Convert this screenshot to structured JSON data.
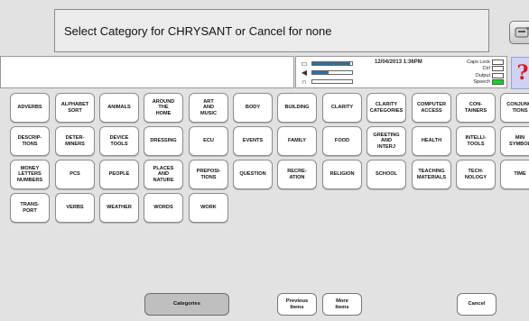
{
  "prompt": {
    "text": "Select Category for CHRYSANT or Cancel for none"
  },
  "help": {
    "label": "?"
  },
  "status": {
    "datetime": "12/04/2013 1:36PM",
    "meters": [
      {
        "icon": "calendar-icon",
        "glyph": "▭",
        "level": 0.95
      },
      {
        "icon": "speaker-icon",
        "glyph": "◀",
        "level": 0.4
      },
      {
        "icon": "headphones-icon",
        "glyph": "∩",
        "level": 0.0
      }
    ],
    "lamps": [
      {
        "label": "Caps Lock",
        "on": false
      },
      {
        "label": "Ctrl",
        "on": false
      },
      {
        "label": "Output",
        "on": false
      },
      {
        "label": "Speech",
        "on": true
      }
    ]
  },
  "categories": [
    [
      "ADVERBS",
      "ALPHABET\nSORT",
      "ANIMALS",
      "AROUND\nTHE\nHOME",
      "ART\nAND\nMUSIC",
      "BODY",
      "BUILDING",
      "CLARITY",
      "CLARITY\nCATEGORIES",
      "COMPUTER\nACCESS",
      "CON-\nTAINERS",
      "CONJUNC-\nTIONS"
    ],
    [
      "DESCRIP-\nTIONS",
      "DETER-\nMINERS",
      "DEVICE\nTOOLS",
      "DRESSING",
      "ECU",
      "EVENTS",
      "FAMILY",
      "FOOD",
      "GREETING\nAND\nINTERJ",
      "HEALTH",
      "INTELLI-\nTOOLS",
      "MIN\nSYMBOL"
    ],
    [
      "MONEY\nLETTERS\nNUMBERS",
      "PCS",
      "PEOPLE",
      "PLACES\nAND\nNATURE",
      "PREPOSI-\nTIONS",
      "QUESTION",
      "RECRE-\nATION",
      "RELIGION",
      "SCHOOL",
      "TEACHING\nMATERIALS",
      "TECH-\nNOLOGY",
      "TIME"
    ],
    [
      "TRANS-\nPORT",
      "VERBS",
      "WEATHER",
      "WORDS",
      "WORK"
    ]
  ],
  "footer": {
    "categories_label": "Categories",
    "previous_label": "Previous\nItems",
    "more_label": "More\nItems",
    "cancel_label": "Cancel"
  },
  "colors": {
    "speech_on": "#19d22a",
    "help_red": "#e0151b",
    "help_bg": "#cfd2f3"
  }
}
